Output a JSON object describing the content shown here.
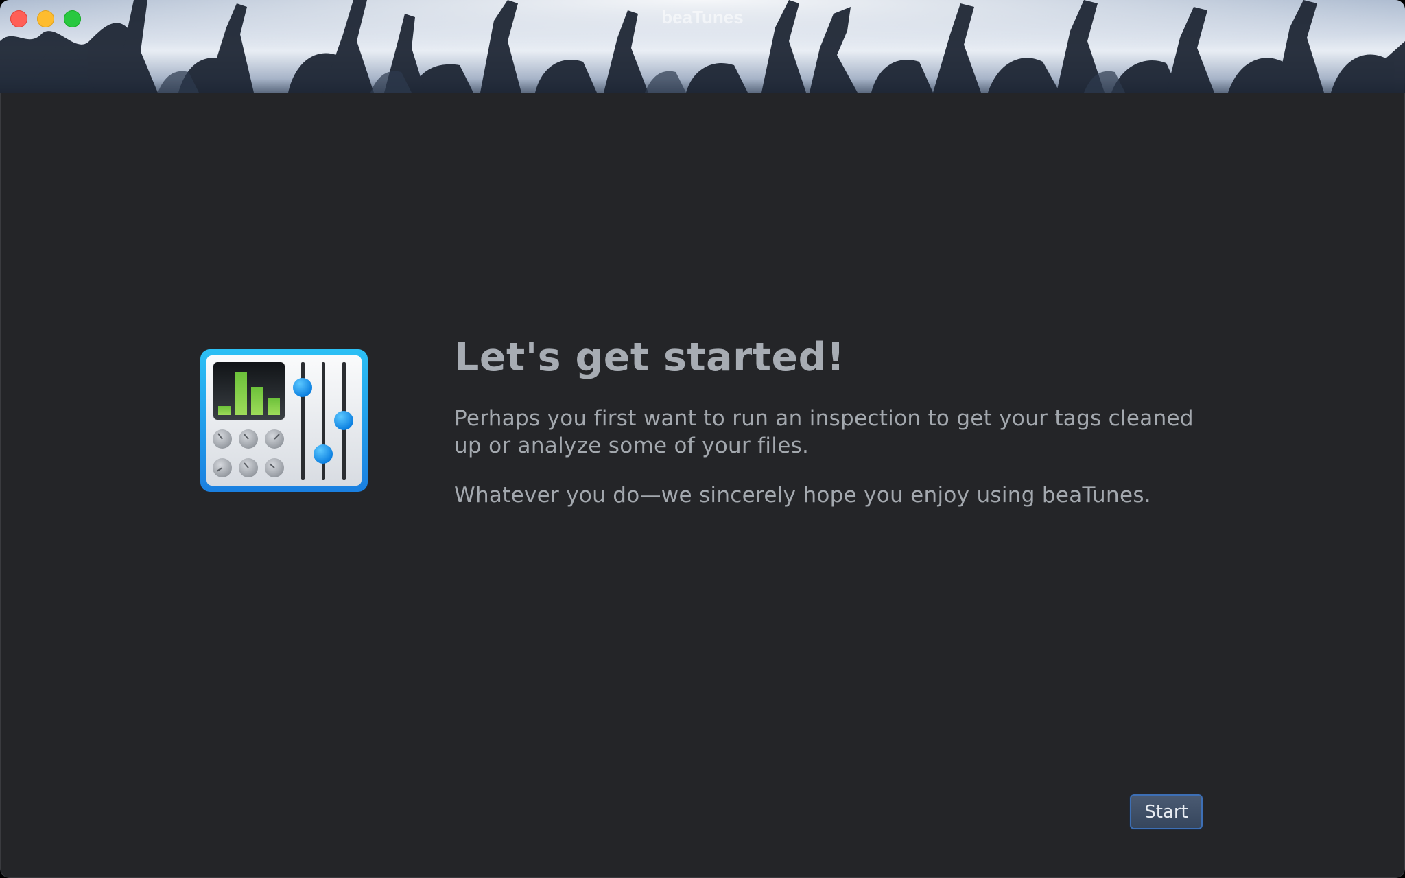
{
  "window": {
    "title": "beaTunes"
  },
  "icons": {
    "close": "close-dot",
    "minimize": "minimize-dot",
    "maximize": "maximize-dot",
    "app": "mixer-equalizer-icon"
  },
  "colors": {
    "background": "#242528",
    "heading": "#a7acb3",
    "text": "#a3a8ae",
    "button_border": "#3d6fb5",
    "accent_blue": "#1e9bf0",
    "eq_green": "#6cc13a"
  },
  "welcome": {
    "heading": "Let's get started!",
    "paragraph1": "Perhaps you first want to run an inspection to get your tags cleaned up or analyze some of your files.",
    "paragraph2": "Whatever you do—we sincerely hope you enjoy using beaTunes."
  },
  "footer": {
    "start_label": "Start"
  }
}
